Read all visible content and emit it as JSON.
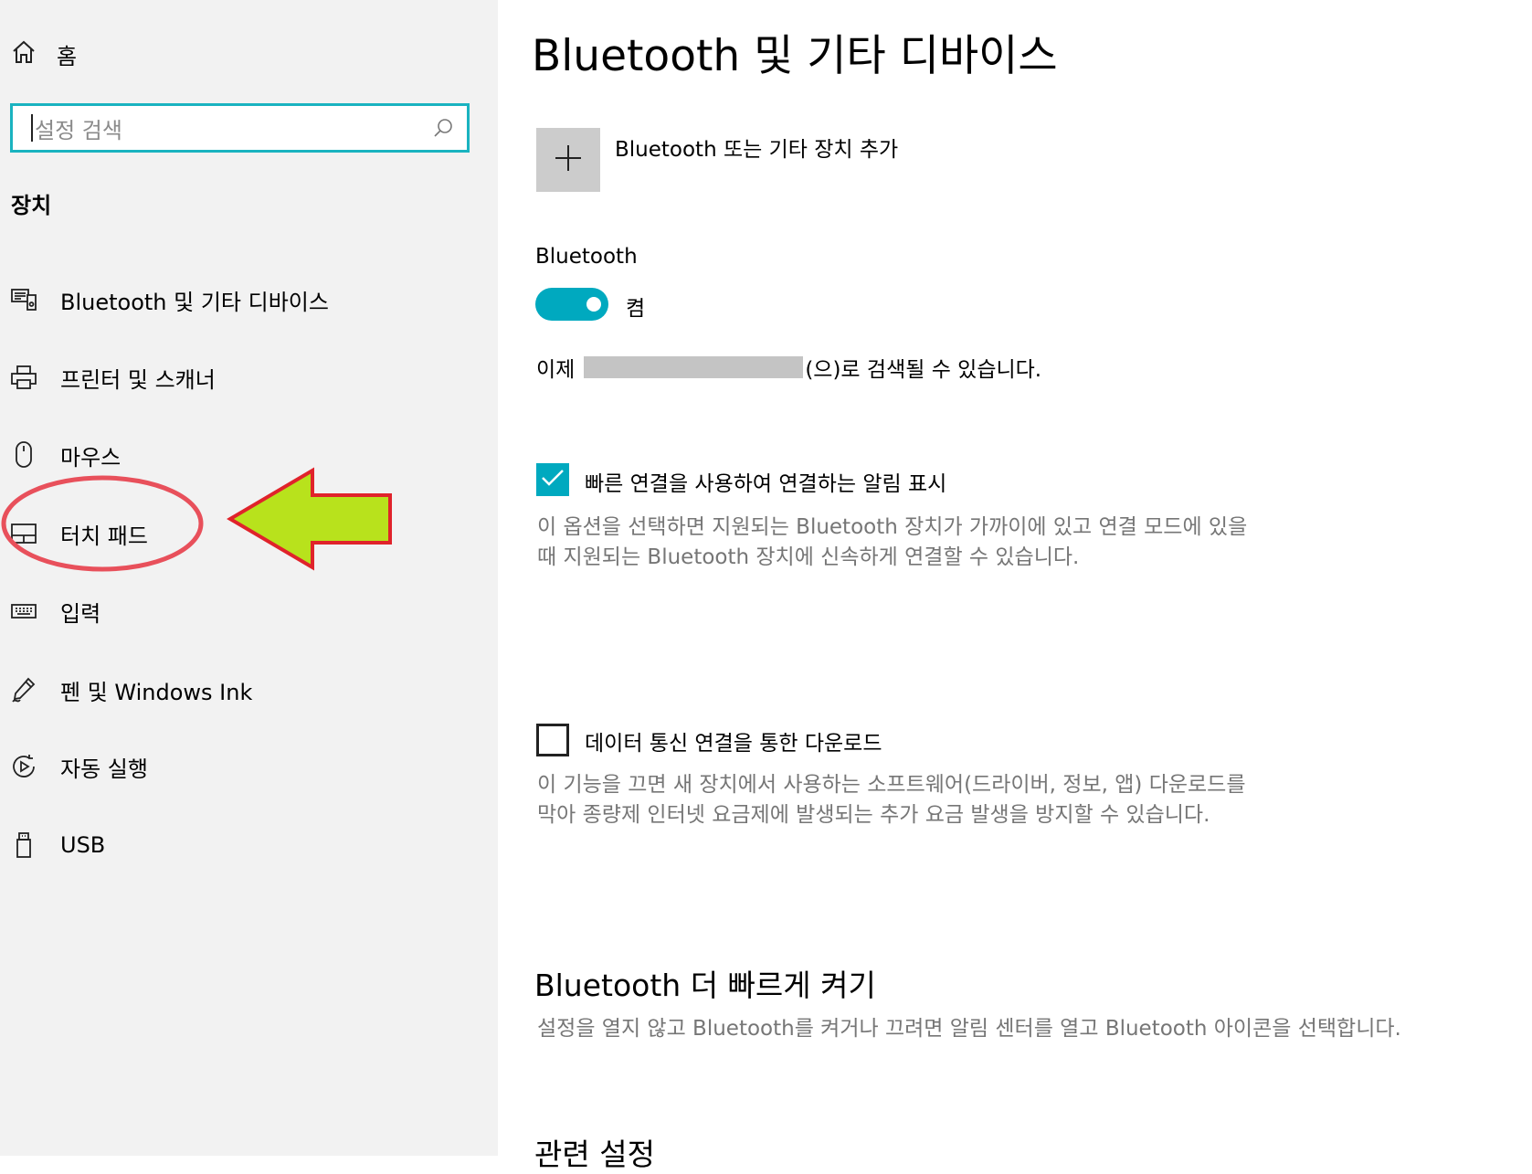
{
  "sidebar": {
    "home_label": "홈",
    "search_placeholder": "설정 검색",
    "section_title": "장치",
    "items": [
      {
        "label": "Bluetooth 및 기타 디바이스",
        "icon": "devices-icon"
      },
      {
        "label": "프린터 및 스캐너",
        "icon": "printer-icon"
      },
      {
        "label": "마우스",
        "icon": "mouse-icon"
      },
      {
        "label": "터치 패드",
        "icon": "touchpad-icon"
      },
      {
        "label": "입력",
        "icon": "keyboard-icon"
      },
      {
        "label": "펜 및 Windows Ink",
        "icon": "pen-icon"
      },
      {
        "label": "자동 실행",
        "icon": "autoplay-icon"
      },
      {
        "label": "USB",
        "icon": "usb-icon"
      }
    ]
  },
  "main": {
    "title": "Bluetooth 및 기타 디바이스",
    "add_device_label": "Bluetooth 또는 기타 장치 추가",
    "bluetooth_label": "Bluetooth",
    "bluetooth_state": "켬",
    "bluetooth_on": true,
    "discoverable_prefix": "이제",
    "discoverable_suffix": "(으)로 검색될 수 있습니다.",
    "swift_pair": {
      "checked": true,
      "label": "빠른 연결을 사용하여 연결하는 알림 표시",
      "desc": "이 옵션을 선택하면 지원되는 Bluetooth 장치가 가까이에 있고 연결 모드에 있을 때 지원되는 Bluetooth 장치에 신속하게 연결할 수 있습니다."
    },
    "metered": {
      "checked": false,
      "label": "데이터 통신 연결을 통한 다운로드",
      "desc": "이 기능을 끄면 새 장치에서 사용하는 소프트웨어(드라이버, 정보, 앱) 다운로드를 막아 종량제 인터넷 요금제에 발생되는 추가 요금 발생을 방지할 수 있습니다."
    },
    "faster_heading": "Bluetooth 더 빠르게 켜기",
    "faster_desc": "설정을 열지 않고 Bluetooth를 켜거나 끄려면 알림 센터를 열고 Bluetooth 아이콘을 선택합니다.",
    "related_heading": "관련 설정"
  },
  "colors": {
    "accent": "#00a9bf",
    "search_border": "#1ab3c0",
    "callout_ellipse": "#e8505b",
    "callout_arrow_fill": "#b8e21c",
    "callout_arrow_stroke": "#e0232b"
  }
}
